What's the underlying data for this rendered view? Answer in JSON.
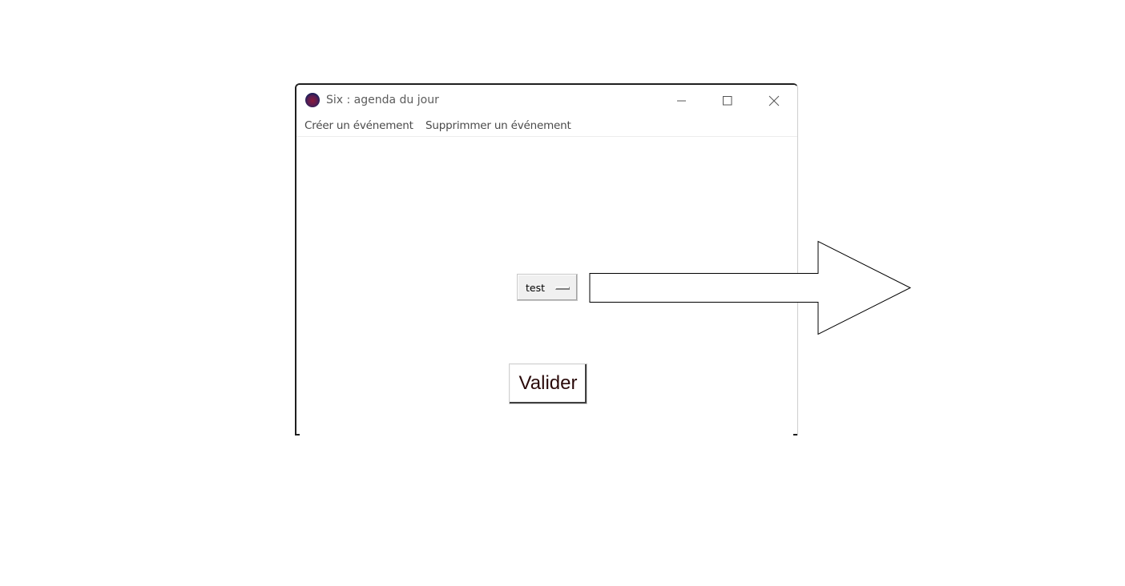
{
  "window": {
    "title": "Six : agenda du jour",
    "controls": {
      "minimize": "minimize-icon",
      "maximize": "maximize-icon",
      "close": "close-icon"
    }
  },
  "menubar": {
    "items": [
      {
        "label": "Créer un événement"
      },
      {
        "label": "Supprimmer un événement"
      }
    ]
  },
  "form": {
    "option_menu": {
      "selected": "test"
    },
    "validate_label": "Valider"
  },
  "annotation": {
    "arrow_icon": "right-arrow-icon",
    "arrow_fill": "#ffffff",
    "arrow_stroke": "#000000"
  }
}
